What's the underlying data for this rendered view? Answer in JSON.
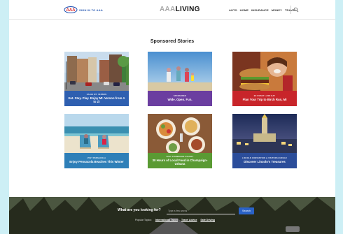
{
  "header": {
    "logo_alt": "AAA",
    "sign_in": "SIGN IN TO AAA",
    "brand_aaa": "AAA",
    "brand_living": "LIVING",
    "nav": [
      "AUTO",
      "HOME",
      "INSURANCE",
      "MONEY",
      "TRAVEL"
    ]
  },
  "main": {
    "section_title": "Sponsored Stories",
    "cards": [
      {
        "kicker": "SALES MT. VERNON",
        "title": "Eat. Stay. Play. Enjoy Mt. Vernon from A to Z!",
        "color": "#2e5fb0"
      },
      {
        "kicker": "SPONSORED",
        "title": "Wide. Open. Fun.",
        "color": "#6b3ea0"
      },
      {
        "kicker": "EX ROSEY LAND BAY",
        "title": "Plan Your Trip to Birch Run, MI",
        "color": "#c8252a"
      },
      {
        "kicker": "VISIT PENSACOLA",
        "title": "Enjoy Pensacola Beaches This Winter",
        "color": "#2e7fb8"
      },
      {
        "kicker": "VISIT CHAMPAIGN COUNTY",
        "title": "30 Hours of Local Food in Champaign-Urbana",
        "color": "#5a9a33"
      },
      {
        "kicker": "LINCOLN CONVENTION & VISITORS BUREAU",
        "title": "Discover Lincoln's Treasures",
        "color": "#2b4d9a"
      }
    ]
  },
  "footer": {
    "question": "What are you looking for?",
    "search_placeholder": "Type a few words",
    "search_button": "Search",
    "topics_label": "Popular Topics:",
    "topics": [
      "International Travel",
      "Travel Advice",
      "Safe Driving"
    ]
  }
}
